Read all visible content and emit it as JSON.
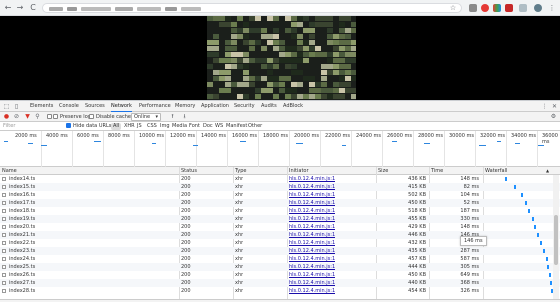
{
  "browser": {
    "back_icon": "←",
    "forward_icon": "→",
    "reload_icon": "C",
    "star_icon": "☆"
  },
  "devtools": {
    "tabs": [
      "Elements",
      "Console",
      "Sources",
      "Network",
      "Performance",
      "Memory",
      "Application",
      "Security",
      "Audits",
      "AdBlock"
    ],
    "active_tab": "Network",
    "toolbar": {
      "preserve_log": "Preserve log",
      "disable_cache": "Disable cache",
      "throttle": "Online"
    },
    "filter": {
      "placeholder": "Filter",
      "hide_data_urls": "Hide data URLs",
      "types": [
        "All",
        "XHR",
        "JS",
        "CSS",
        "Img",
        "Media",
        "Font",
        "Doc",
        "WS",
        "Manifest",
        "Other"
      ]
    },
    "timeline_ticks": [
      "2000 ms",
      "4000 ms",
      "6000 ms",
      "8000 ms",
      "10000 ms",
      "12000 ms",
      "14000 ms",
      "16000 ms",
      "18000 ms",
      "20000 ms",
      "22000 ms",
      "24000 ms",
      "26000 ms",
      "28000 ms",
      "30000 ms",
      "32000 ms",
      "34000 ms",
      "36000 ms"
    ],
    "columns": {
      "name": "Name",
      "status": "Status",
      "type": "Type",
      "initiator": "Initiator",
      "size": "Size",
      "time": "Time",
      "waterfall": "Waterfall"
    },
    "rows": [
      {
        "name": "index14.ts",
        "status": "200",
        "type": "xhr",
        "initiator": "hls.0.12.4.min.js:1",
        "size": "436 KB",
        "time": "148 ms"
      },
      {
        "name": "index15.ts",
        "status": "200",
        "type": "xhr",
        "initiator": "hls.0.12.4.min.js:1",
        "size": "415 KB",
        "time": "82 ms"
      },
      {
        "name": "index16.ts",
        "status": "200",
        "type": "xhr",
        "initiator": "hls.0.12.4.min.js:1",
        "size": "502 KB",
        "time": "104 ms"
      },
      {
        "name": "index17.ts",
        "status": "200",
        "type": "xhr",
        "initiator": "hls.0.12.4.min.js:1",
        "size": "450 KB",
        "time": "52 ms"
      },
      {
        "name": "index18.ts",
        "status": "200",
        "type": "xhr",
        "initiator": "hls.0.12.4.min.js:1",
        "size": "518 KB",
        "time": "187 ms"
      },
      {
        "name": "index19.ts",
        "status": "200",
        "type": "xhr",
        "initiator": "hls.0.12.4.min.js:1",
        "size": "455 KB",
        "time": "330 ms"
      },
      {
        "name": "index20.ts",
        "status": "200",
        "type": "xhr",
        "initiator": "hls.0.12.4.min.js:1",
        "size": "429 KB",
        "time": "148 ms"
      },
      {
        "name": "index21.ts",
        "status": "200",
        "type": "xhr",
        "initiator": "hls.0.12.4.min.js:1",
        "size": "446 KB",
        "time": "146 ms"
      },
      {
        "name": "index22.ts",
        "status": "200",
        "type": "xhr",
        "initiator": "hls.0.12.4.min.js:1",
        "size": "432 KB",
        "time": "249 ms"
      },
      {
        "name": "index23.ts",
        "status": "200",
        "type": "xhr",
        "initiator": "hls.0.12.4.min.js:1",
        "size": "435 KB",
        "time": "287 ms"
      },
      {
        "name": "index24.ts",
        "status": "200",
        "type": "xhr",
        "initiator": "hls.0.12.4.min.js:1",
        "size": "457 KB",
        "time": "587 ms"
      },
      {
        "name": "index25.ts",
        "status": "200",
        "type": "xhr",
        "initiator": "hls.0.12.4.min.js:1",
        "size": "444 KB",
        "time": "305 ms"
      },
      {
        "name": "index26.ts",
        "status": "200",
        "type": "xhr",
        "initiator": "hls.0.12.4.min.js:1",
        "size": "450 KB",
        "time": "649 ms"
      },
      {
        "name": "index27.ts",
        "status": "200",
        "type": "xhr",
        "initiator": "hls.0.12.4.min.js:1",
        "size": "440 KB",
        "time": "368 ms"
      },
      {
        "name": "index28.ts",
        "status": "200",
        "type": "xhr",
        "initiator": "hls.0.12.4.min.js:1",
        "size": "454 KB",
        "time": "326 ms"
      }
    ],
    "tooltip": "146 ms",
    "colors": {
      "accent": "#1a73e8",
      "waterfall": "#1e90ff",
      "record_red": "#d93025"
    }
  }
}
